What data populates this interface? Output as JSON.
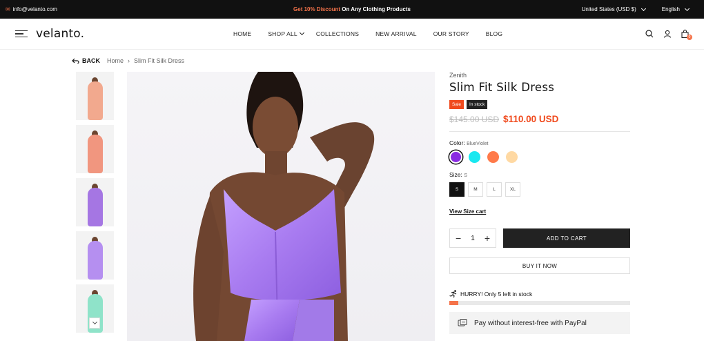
{
  "topbar": {
    "email": "info@velanto.com",
    "promo_highlight": "Get 10% Discount",
    "promo_rest": "On Any Clothing Products",
    "currency": "United States (USD $)",
    "language": "English"
  },
  "header": {
    "logo": "velanto.",
    "nav": [
      "HOME",
      "SHOP ALL",
      "COLLECTIONS",
      "NEW ARRIVAL",
      "OUR STORY",
      "BLOG"
    ],
    "cart_count": "0"
  },
  "breadcrumb": {
    "back": "BACK",
    "home": "Home",
    "current": "Slim Fit Silk Dress"
  },
  "thumbnails": [
    {
      "color": "#f2a98e",
      "label": "peach"
    },
    {
      "color": "#f1967f",
      "label": "salmon"
    },
    {
      "color": "#a576e3",
      "label": "violet-model"
    },
    {
      "color": "#b58ff0",
      "label": "violet-flat"
    },
    {
      "color": "#8fe3c9",
      "label": "mint"
    }
  ],
  "product": {
    "brand": "Zenith",
    "title": "Slim Fit Silk Dress",
    "badge_sale": "Sale",
    "badge_stock": "In stock",
    "old_price": "$145.00 USD",
    "new_price": "$110.00 USD",
    "color_label": "Color:",
    "color_value": "BlueViolet",
    "colors": [
      "#8a2be2",
      "#19e8f0",
      "#ff7a4a",
      "#ffd9a3"
    ],
    "size_label": "Size:",
    "size_value": "S",
    "sizes": [
      "S",
      "M",
      "L",
      "XL"
    ],
    "size_chart": "View Size cart",
    "qty": "1",
    "add_to_cart": "ADD TO CART",
    "buy_now": "BUY IT NOW",
    "hurry": "HURRY! Only 5 left in stock",
    "stock_fraction": 0.05,
    "paypal": "Pay without interest-free with PayPal"
  }
}
